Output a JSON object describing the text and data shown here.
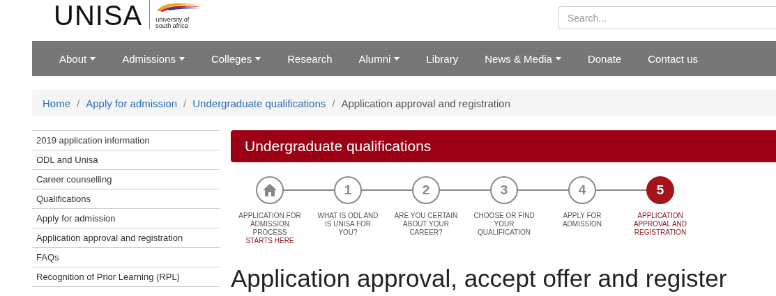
{
  "logo": {
    "name": "UNISA",
    "tagline": "university of south africa"
  },
  "search": {
    "placeholder": "Search..."
  },
  "nav": [
    {
      "label": "About",
      "dropdown": true
    },
    {
      "label": "Admissions",
      "dropdown": true
    },
    {
      "label": "Colleges",
      "dropdown": true
    },
    {
      "label": "Research",
      "dropdown": false
    },
    {
      "label": "Alumni",
      "dropdown": true
    },
    {
      "label": "Library",
      "dropdown": false
    },
    {
      "label": "News & Media",
      "dropdown": true
    },
    {
      "label": "Donate",
      "dropdown": false
    },
    {
      "label": "Contact us",
      "dropdown": false
    }
  ],
  "breadcrumb_separator": "/",
  "breadcrumb": [
    {
      "label": "Home",
      "current": false
    },
    {
      "label": "Apply for admission",
      "current": false
    },
    {
      "label": "Undergraduate qualifications",
      "current": false
    },
    {
      "label": "Application approval and registration",
      "current": true
    }
  ],
  "sidebar": {
    "items": [
      "2019 application information",
      "ODL and Unisa",
      "Career counselling",
      "Qualifications",
      "Apply for admission",
      "Application approval and registration",
      "FAQs",
      "Recognition of Prior Learning (RPL)"
    ]
  },
  "section_title": "Undergraduate qualifications",
  "steps": [
    {
      "kind": "home",
      "label": "APPLICATION FOR ADMISSION PROCESS",
      "note": "STARTS HERE",
      "selected": false
    },
    {
      "kind": "number",
      "number": "1",
      "label": "WHAT IS ODL AND IS UNISA FOR YOU?",
      "selected": false
    },
    {
      "kind": "number",
      "number": "2",
      "label": "ARE YOU CERTAIN ABOUT YOUR CAREER?",
      "selected": false
    },
    {
      "kind": "number",
      "number": "3",
      "label": "CHOOSE OR FIND YOUR QUALIFICATION",
      "selected": false
    },
    {
      "kind": "number",
      "number": "4",
      "label": "APPLY FOR ADMISSION",
      "selected": false
    },
    {
      "kind": "number",
      "number": "5",
      "label": "APPLICATION APPROVAL AND REGISTRATION",
      "selected": true
    }
  ],
  "heading": "Application approval, accept offer and register"
}
